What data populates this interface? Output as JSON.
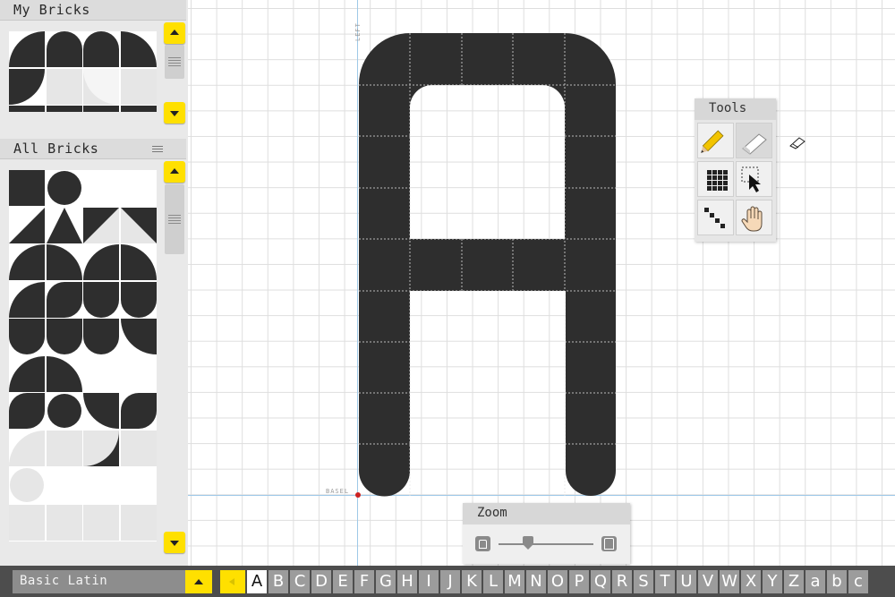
{
  "colors": {
    "accent": "#ffe000",
    "brick": "#2e2e2e",
    "brick_light": "#e6e6e6",
    "guide": "#9fc9e8"
  },
  "sidebar": {
    "my_bricks": {
      "title": "My Bricks"
    },
    "all_bricks": {
      "title": "All Bricks",
      "menu_icon": "hamburger-icon"
    }
  },
  "canvas": {
    "guide_left_label": "LEFT",
    "guide_baseline_label": "BASEL"
  },
  "tools": {
    "title": "Tools",
    "items": [
      {
        "name": "pencil-icon",
        "active": false
      },
      {
        "name": "eraser-icon",
        "active": true
      },
      {
        "name": "grid-fill-icon",
        "active": false
      },
      {
        "name": "selection-arrow-icon",
        "active": false
      },
      {
        "name": "diagonal-line-icon",
        "active": false
      },
      {
        "name": "hand-pan-icon",
        "active": false
      }
    ]
  },
  "zoom": {
    "title": "Zoom",
    "zoom_out_icon": "small-a-icon",
    "zoom_in_icon": "large-a-icon",
    "level": 0.31
  },
  "bottombar": {
    "charset_label": "Basic Latin",
    "glyphs": [
      "A",
      "B",
      "C",
      "D",
      "E",
      "F",
      "G",
      "H",
      "I",
      "J",
      "K",
      "L",
      "M",
      "N",
      "O",
      "P",
      "Q",
      "R",
      "S",
      "T",
      "U",
      "V",
      "W",
      "X",
      "Y",
      "Z",
      "a",
      "b",
      "c"
    ],
    "selected_glyph": "A"
  }
}
